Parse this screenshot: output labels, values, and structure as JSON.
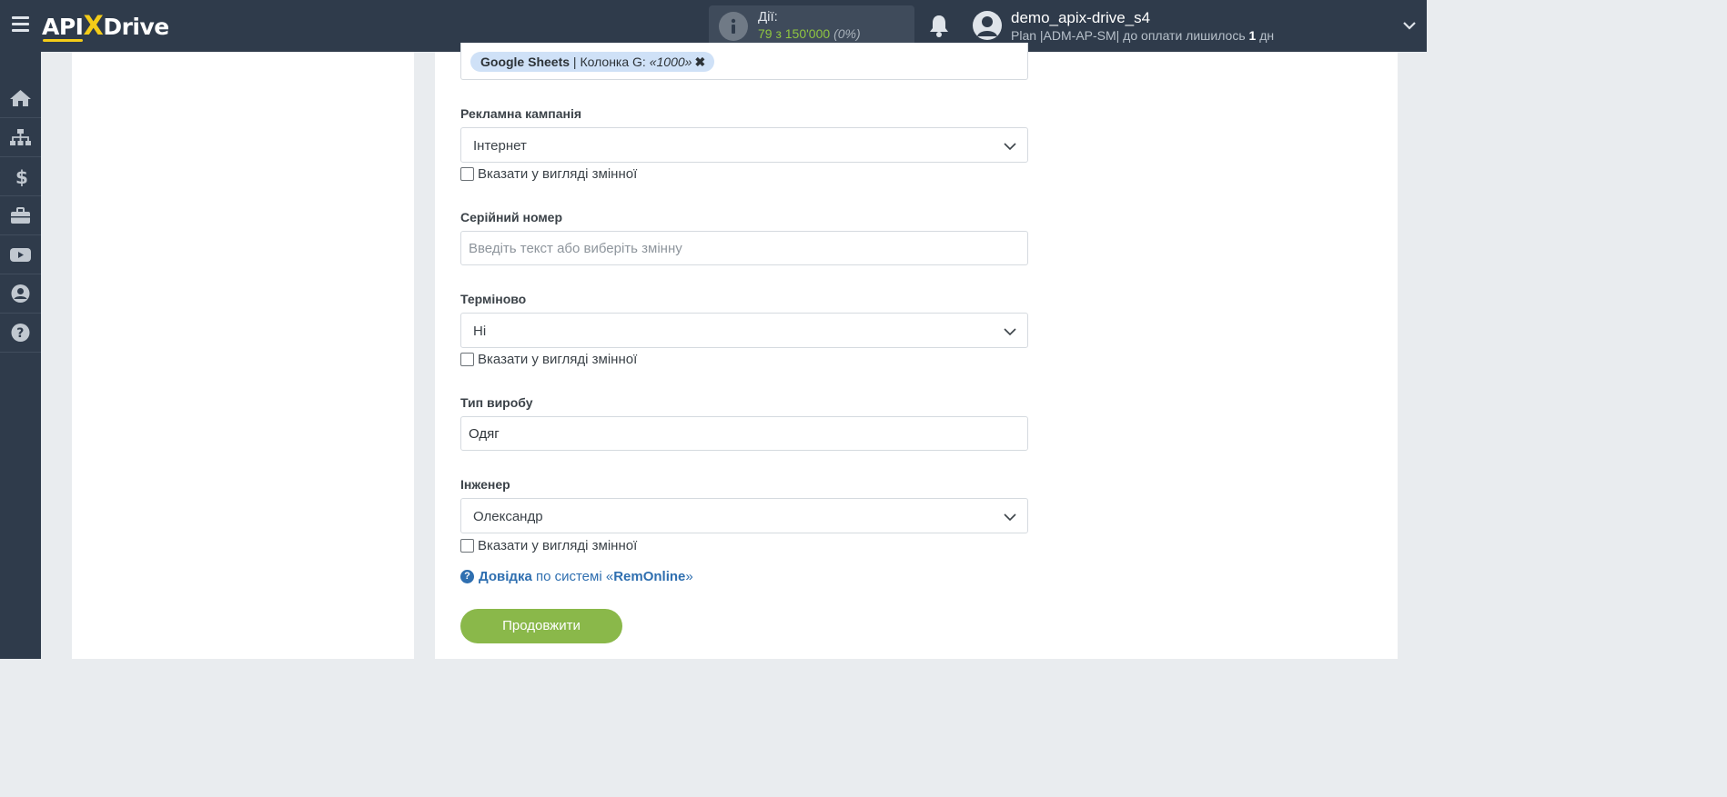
{
  "header": {
    "logo_text_a": "API",
    "logo_text_x": "X",
    "logo_text_b": "Drive",
    "actions_label": "Дії:",
    "actions_count": "79 з 150'000",
    "actions_pct": "(0%)",
    "username": "demo_apix-drive_s4",
    "plan_prefix": "Plan |ADM-AP-SM| до оплати лишилось ",
    "plan_days": "1",
    "plan_suffix": " дн"
  },
  "sidebar": {
    "items": [
      {
        "icon": "home-icon"
      },
      {
        "icon": "sitemap-icon"
      },
      {
        "icon": "dollar-icon"
      },
      {
        "icon": "briefcase-icon"
      },
      {
        "icon": "youtube-icon"
      },
      {
        "icon": "user-circle-icon"
      },
      {
        "icon": "question-circle-icon"
      }
    ]
  },
  "form": {
    "tag": {
      "source": "Google Sheets",
      "sep": " | ",
      "column": "Колонка G: ",
      "value": "«1000»",
      "remove": "✖"
    },
    "campaign": {
      "label": "Рекламна кампанія",
      "value": "Інтернет",
      "checkbox": "Вказати у вигляді змінної"
    },
    "serial": {
      "label": "Серійний номер",
      "placeholder": "Введіть текст або виберіть змінну"
    },
    "urgent": {
      "label": "Терміново",
      "value": "Ні",
      "checkbox": "Вказати у вигляді змінної"
    },
    "product_type": {
      "label": "Тип виробу",
      "value": "Одяг"
    },
    "engineer": {
      "label": "Інженер",
      "value": "Олександр",
      "checkbox": "Вказати у вигляді змінної"
    },
    "help": {
      "icon": "?",
      "link": "Довідка",
      "middle": " по системі «",
      "system": "RemOnline",
      "end": "»"
    },
    "continue_label": "Продовжити"
  },
  "colors": {
    "header_bg": "#2f3b4b",
    "accent_yellow": "#f4cc18",
    "counter_green": "#8fc541",
    "button_green": "#8ab84a",
    "tag_bg": "#cfe1f7",
    "link_blue": "#2f6fb0"
  }
}
